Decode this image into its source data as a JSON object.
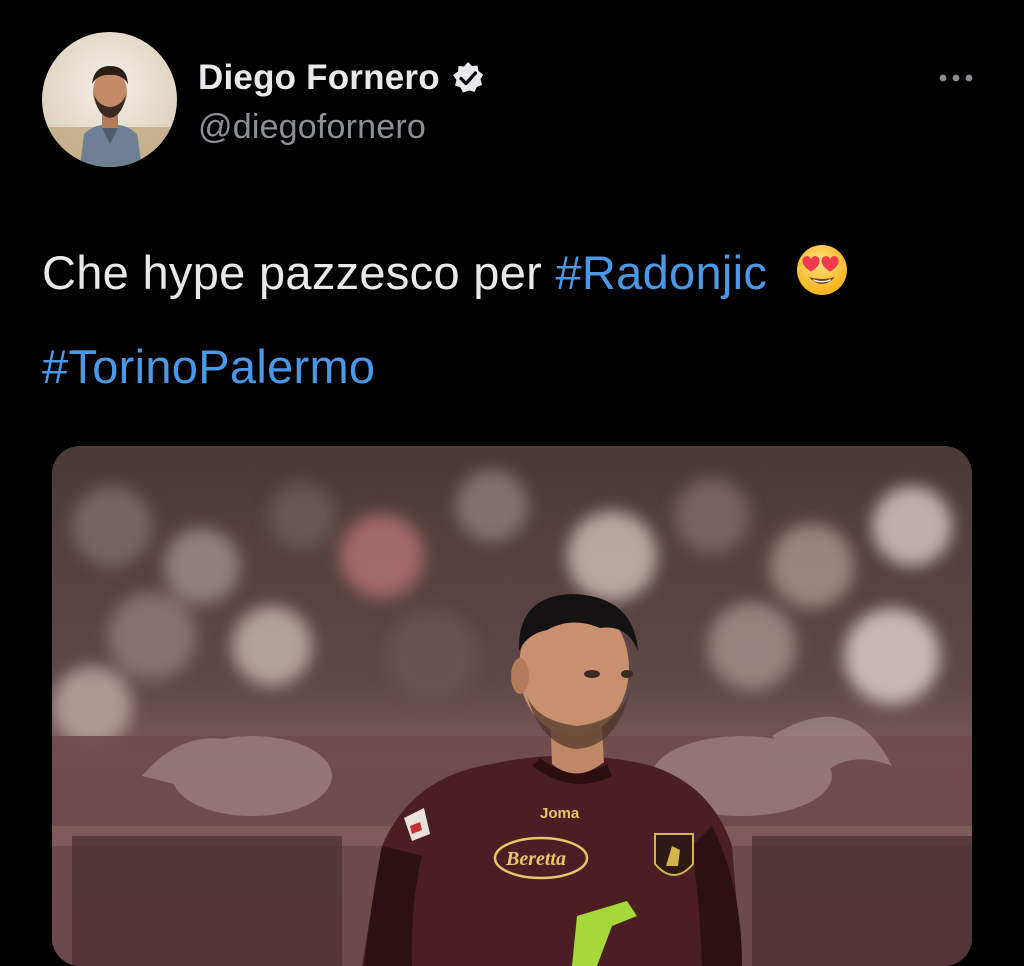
{
  "author": {
    "display_name": "Diego Fornero",
    "handle": "@diegofornero",
    "verified": true,
    "avatar_icon": "user-avatar-photo"
  },
  "tweet": {
    "text_plain": "Che hype pazzesco per",
    "hashtags": [
      "#Radonjic",
      "#TorinoPalermo"
    ],
    "emoji": "heart-eyes-emoji",
    "more_icon": "more-horizontal-icon"
  },
  "media": {
    "image_icon": "football-player-photo",
    "sponsor_top": "Joma",
    "sponsor_main": "Beretta",
    "badge_text": "TORINO FC"
  },
  "colors": {
    "background": "#000000",
    "text": "#e7e9ea",
    "secondary": "#8b9096",
    "link": "#4a99e9",
    "jersey": "#4a1e22",
    "accent": "#a6d83a"
  }
}
